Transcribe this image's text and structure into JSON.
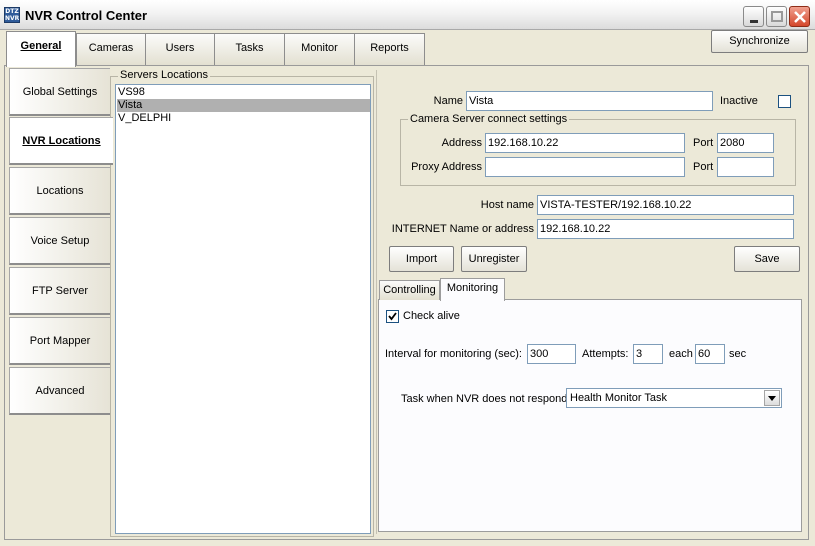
{
  "window": {
    "title": "NVR Control Center",
    "icon_text": "DTZ NVR"
  },
  "tabs": [
    {
      "label": "General",
      "active": true
    },
    {
      "label": "Cameras"
    },
    {
      "label": "Users"
    },
    {
      "label": "Tasks"
    },
    {
      "label": "Monitor"
    },
    {
      "label": "Reports"
    }
  ],
  "toolbar": {
    "synchronize_label": "Synchronize"
  },
  "side_tabs": [
    {
      "label": "Global Settings"
    },
    {
      "label": "NVR Locations",
      "active": true
    },
    {
      "label": "Locations"
    },
    {
      "label": "Voice Setup"
    },
    {
      "label": "FTP Server"
    },
    {
      "label": "Port Mapper"
    },
    {
      "label": "Advanced"
    }
  ],
  "servers": {
    "group_label": "Servers Locations",
    "items": [
      "VS98",
      "Vista",
      "V_DELPHI"
    ],
    "selected": "Vista"
  },
  "details": {
    "name_label": "Name",
    "name_value": "Vista",
    "inactive_label": "Inactive",
    "inactive_checked": false,
    "camera_group_label": "Camera Server connect settings",
    "address_label": "Address",
    "address_value": "192.168.10.22",
    "port_label": "Port",
    "port_value": "2080",
    "proxy_label": "Proxy Address",
    "proxy_value": "",
    "proxy_port_label": "Port",
    "proxy_port_value": "",
    "host_label": "Host name",
    "host_value": "VISTA-TESTER/192.168.10.22",
    "internet_label": "INTERNET Name or address",
    "internet_value": "192.168.10.22",
    "import_label": "Import",
    "unregister_label": "Unregister",
    "save_label": "Save"
  },
  "subtabs": [
    {
      "label": "Controlling"
    },
    {
      "label": "Monitoring",
      "active": true
    }
  ],
  "monitoring": {
    "check_alive_label": "Check alive",
    "check_alive_checked": true,
    "interval_label": "Interval for monitoring (sec):",
    "interval_value": "300",
    "attempts_label": "Attempts:",
    "attempts_value": "3",
    "each_label": "each",
    "each_value": "60",
    "sec_label": "sec",
    "task_label": "Task when NVR does not respond:",
    "task_value": "Health Monitor Task"
  },
  "colors": {
    "window_bg": "#ece9d8",
    "selection": "#b0b0b0",
    "input_border": "#7f9db9"
  }
}
